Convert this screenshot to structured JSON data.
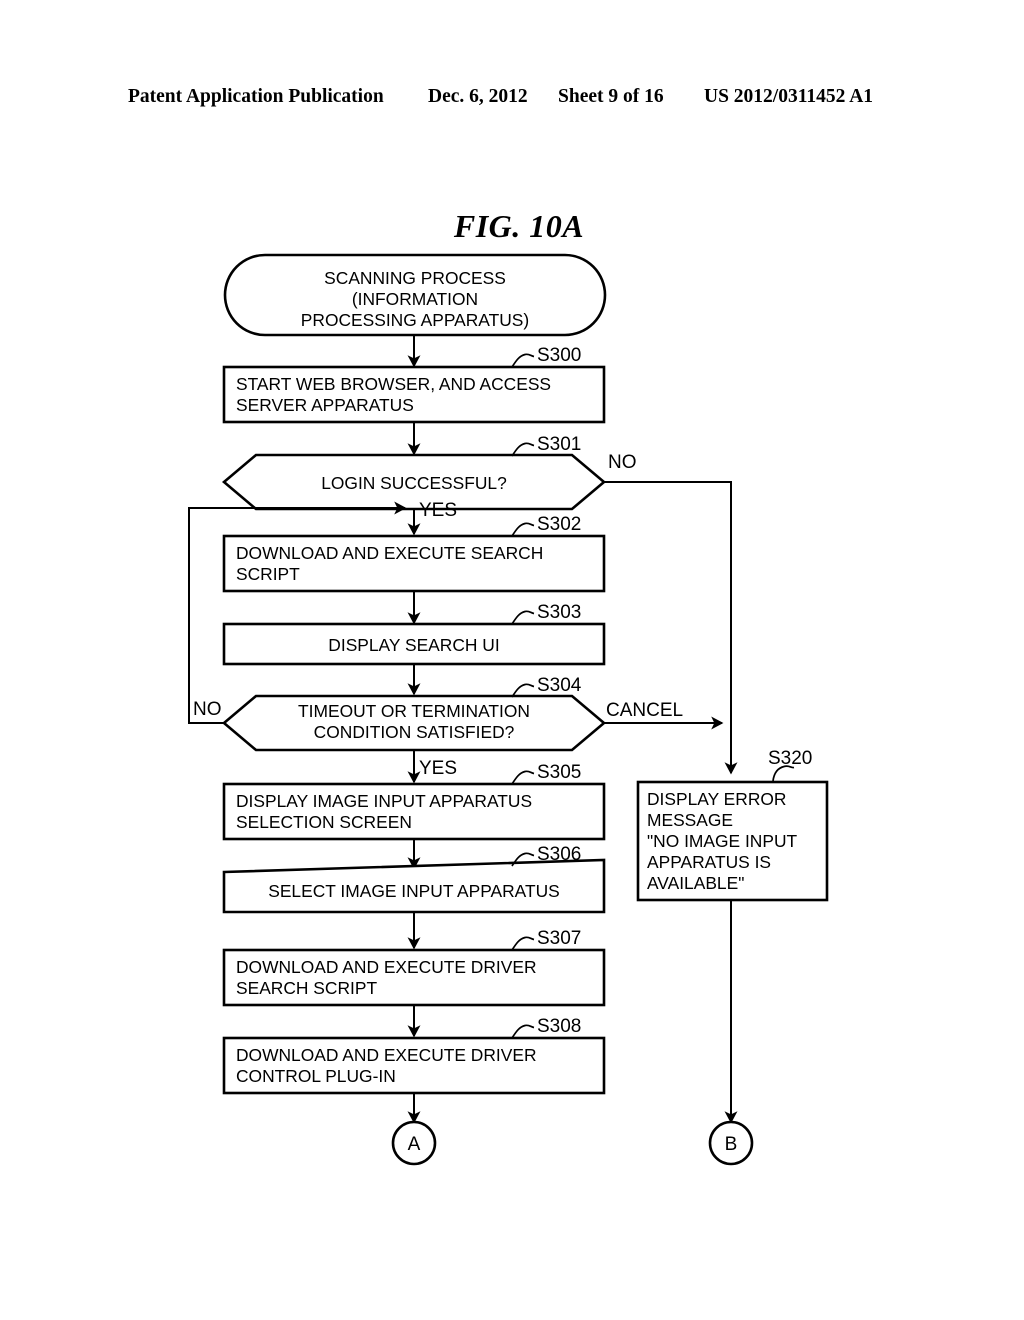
{
  "header": {
    "publication": "Patent Application Publication",
    "date": "Dec. 6, 2012",
    "sheet": "Sheet 9 of 16",
    "patent_number": "US 2012/0311452 A1"
  },
  "figure": {
    "title": "FIG. 10A"
  },
  "flowchart": {
    "start": {
      "id": "start-terminator",
      "lines": [
        "SCANNING PROCESS",
        "(INFORMATION",
        "PROCESSING APPARATUS)"
      ]
    },
    "steps": [
      {
        "id": "S300",
        "label": "S300",
        "shape": "process",
        "align": "left",
        "lines": [
          "START WEB BROWSER, AND ACCESS",
          "SERVER APPARATUS"
        ]
      },
      {
        "id": "S301",
        "label": "S301",
        "shape": "decision",
        "align": "center",
        "lines": [
          "LOGIN SUCCESSFUL?"
        ],
        "branch_right": "NO",
        "branch_down": "YES"
      },
      {
        "id": "S302",
        "label": "S302",
        "shape": "process",
        "align": "left",
        "lines": [
          "DOWNLOAD AND EXECUTE SEARCH",
          "SCRIPT"
        ]
      },
      {
        "id": "S303",
        "label": "S303",
        "shape": "process",
        "align": "center",
        "lines": [
          "DISPLAY SEARCH UI"
        ]
      },
      {
        "id": "S304",
        "label": "S304",
        "shape": "decision",
        "align": "center",
        "lines": [
          "TIMEOUT OR TERMINATION",
          "CONDITION SATISFIED?"
        ],
        "branch_left": "NO",
        "branch_right": "CANCEL",
        "branch_down": "YES"
      },
      {
        "id": "S305",
        "label": "S305",
        "shape": "process",
        "align": "left",
        "lines": [
          "DISPLAY IMAGE INPUT APPARATUS",
          "SELECTION SCREEN"
        ]
      },
      {
        "id": "S306",
        "label": "S306",
        "shape": "process",
        "align": "center",
        "lines": [
          "SELECT IMAGE INPUT APPARATUS"
        ]
      },
      {
        "id": "S307",
        "label": "S307",
        "shape": "process",
        "align": "left",
        "lines": [
          "DOWNLOAD AND EXECUTE DRIVER",
          "SEARCH SCRIPT"
        ]
      },
      {
        "id": "S308",
        "label": "S308",
        "shape": "process",
        "align": "left",
        "lines": [
          "DOWNLOAD AND EXECUTE DRIVER",
          "CONTROL PLUG-IN"
        ]
      },
      {
        "id": "S320",
        "label": "S320",
        "shape": "process",
        "align": "left",
        "lines": [
          "DISPLAY ERROR",
          "MESSAGE",
          "\"NO IMAGE INPUT",
          "APPARATUS IS",
          "AVAILABLE\""
        ]
      }
    ],
    "connectors": [
      {
        "id": "connector-a",
        "text": "A"
      },
      {
        "id": "connector-b",
        "text": "B"
      }
    ],
    "branch_labels": {
      "s301_no": "NO",
      "s301_yes": "YES",
      "s304_no": "NO",
      "s304_cancel": "CANCEL",
      "s304_yes": "YES"
    },
    "colors": {
      "line": "#000000",
      "fill": "#ffffff",
      "text": "#000000"
    }
  }
}
